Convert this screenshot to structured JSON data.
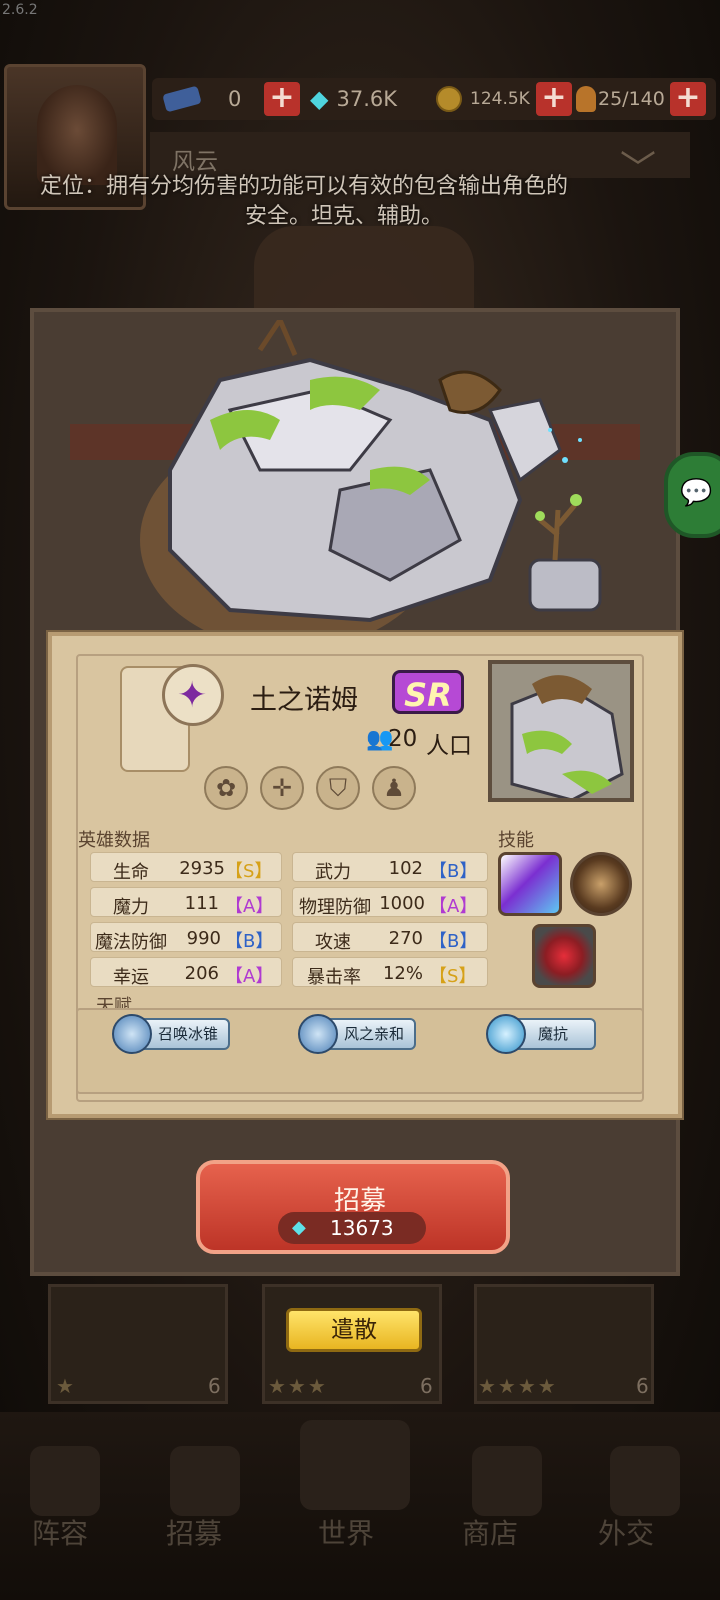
{
  "version": "2.6.2",
  "top_bar": {
    "resources": [
      {
        "icon": "ticket-icon",
        "value": "0"
      },
      {
        "icon": "diamond-icon",
        "value": "37.6K"
      },
      {
        "icon": "gold-coin-icon",
        "value": "124.5K"
      },
      {
        "icon": "meat-icon",
        "value": "25/140"
      }
    ],
    "plus_label": "+"
  },
  "player_name": "风云",
  "role": {
    "line1": "定位：拥有分均伤害的功能可以有效的包含输出角色的",
    "line2": "安全。坦克、辅助。"
  },
  "hero": {
    "name": "土之诺姆",
    "rarity": "SR",
    "population_value": "20",
    "population_unit": "人口",
    "class_icon": "purple-star-gem-icon",
    "traits": [
      "earth-element-icon",
      "crosshair-icon",
      "shield-icon",
      "golem-body-icon"
    ]
  },
  "stats": {
    "title": "英雄数据",
    "rows": [
      {
        "name": "生命",
        "value": "2935",
        "grade": "【S】",
        "grade_class": "S"
      },
      {
        "name": "武力",
        "value": "102",
        "grade": "【B】",
        "grade_class": "B"
      },
      {
        "name": "魔力",
        "value": "111",
        "grade": "【A】",
        "grade_class": "A"
      },
      {
        "name": "物理防御",
        "value": "1000",
        "grade": "【A】",
        "grade_class": "A"
      },
      {
        "name": "魔法防御",
        "value": "990",
        "grade": "【B】",
        "grade_class": "B"
      },
      {
        "name": "攻速",
        "value": "270",
        "grade": "【B】",
        "grade_class": "B"
      },
      {
        "name": "幸运",
        "value": "206",
        "grade": "【A】",
        "grade_class": "A"
      },
      {
        "name": "暴击率",
        "value": "12%",
        "grade": "【S】",
        "grade_class": "S"
      }
    ]
  },
  "skills": {
    "title": "技能",
    "items": [
      "ice-meteor-icon",
      "stone-shield-icon",
      "heart-gear-icon"
    ]
  },
  "talents": {
    "title": "天赋",
    "items": [
      {
        "label": "召唤冰锥",
        "icon": "ice-orb-icon"
      },
      {
        "label": "风之亲和",
        "icon": "wind-orb-icon"
      },
      {
        "label": "魔抗",
        "icon": "magic-shield-icon"
      }
    ]
  },
  "recruit": {
    "label": "招募",
    "cost": "13673"
  },
  "dismiss": {
    "label": "遣散"
  },
  "hero_cards": [
    {
      "stars": "★",
      "cost": "6"
    },
    {
      "stars": "★★★",
      "cost": "6"
    },
    {
      "stars": "★★★★",
      "cost": "6"
    }
  ],
  "bottom_nav": [
    "阵容",
    "招募",
    "世界",
    "商店",
    "外交"
  ]
}
